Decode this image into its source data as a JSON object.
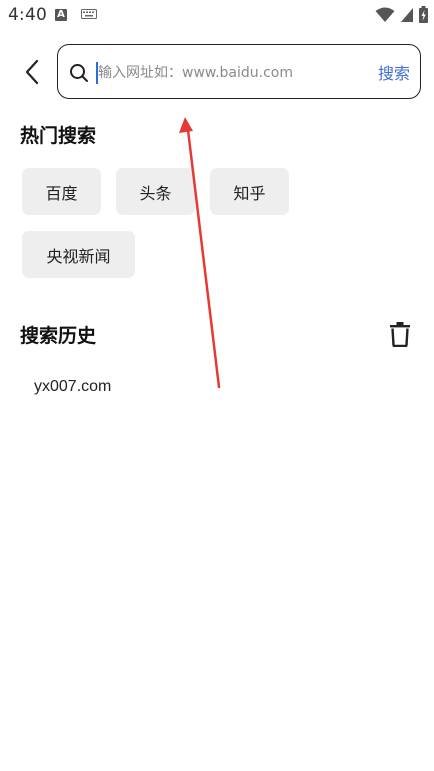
{
  "status_bar": {
    "time": "4:40",
    "notification_icon": "a-icon",
    "keyboard_icon": "keyboard-icon",
    "wifi_icon": "wifi-icon",
    "signal_icon": "signal-icon",
    "battery_icon": "battery-icon"
  },
  "header": {
    "back_icon": "chevron-left-icon",
    "search_icon": "search-icon",
    "placeholder": "输入网址如：www.baidu.com",
    "value": "",
    "submit_label": "搜索"
  },
  "hot_search": {
    "title": "热门搜索",
    "items": [
      {
        "label": "百度"
      },
      {
        "label": "头条"
      },
      {
        "label": "知乎"
      },
      {
        "label": "央视新闻"
      }
    ]
  },
  "history": {
    "title": "搜索历史",
    "clear_icon": "trash-icon",
    "items": [
      {
        "label": "yx007.com"
      }
    ]
  },
  "colors": {
    "accent": "#3d6fcf",
    "chip_bg": "#eeeeee",
    "annotation_arrow": "#e53935"
  }
}
